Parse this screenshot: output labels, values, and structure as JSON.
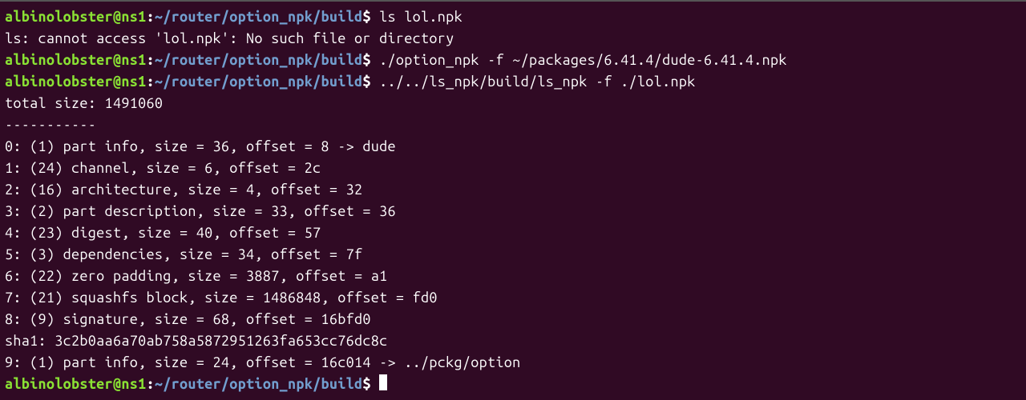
{
  "prompt": {
    "user": "albinolobster",
    "at": "@",
    "host": "ns1",
    "colon": ":",
    "path": "~/router/option_npk/build",
    "dollar": "$"
  },
  "lines": [
    {
      "type": "prompt",
      "cmd": " ls lol.npk"
    },
    {
      "type": "output",
      "text": "ls: cannot access 'lol.npk': No such file or directory"
    },
    {
      "type": "prompt",
      "cmd": " ./option_npk -f ~/packages/6.41.4/dude-6.41.4.npk"
    },
    {
      "type": "prompt",
      "cmd": " ../../ls_npk/build/ls_npk -f ./lol.npk"
    },
    {
      "type": "output",
      "text": "total size: 1491060"
    },
    {
      "type": "output",
      "text": "-----------"
    },
    {
      "type": "output",
      "text": "0: (1) part info, size = 36, offset = 8 -> dude"
    },
    {
      "type": "output",
      "text": "1: (24) channel, size = 6, offset = 2c"
    },
    {
      "type": "output",
      "text": "2: (16) architecture, size = 4, offset = 32"
    },
    {
      "type": "output",
      "text": "3: (2) part description, size = 33, offset = 36"
    },
    {
      "type": "output",
      "text": "4: (23) digest, size = 40, offset = 57"
    },
    {
      "type": "output",
      "text": "5: (3) dependencies, size = 34, offset = 7f"
    },
    {
      "type": "output",
      "text": "6: (22) zero padding, size = 3887, offset = a1"
    },
    {
      "type": "output",
      "text": "7: (21) squashfs block, size = 1486848, offset = fd0"
    },
    {
      "type": "output",
      "text": "8: (9) signature, size = 68, offset = 16bfd0"
    },
    {
      "type": "output",
      "text": "sha1: 3c2b0aa6a70ab758a5872951263fa653cc76dc8c"
    },
    {
      "type": "output",
      "text": "9: (1) part info, size = 24, offset = 16c014 -> ../pckg/option"
    },
    {
      "type": "prompt_cursor",
      "cmd": " "
    }
  ]
}
